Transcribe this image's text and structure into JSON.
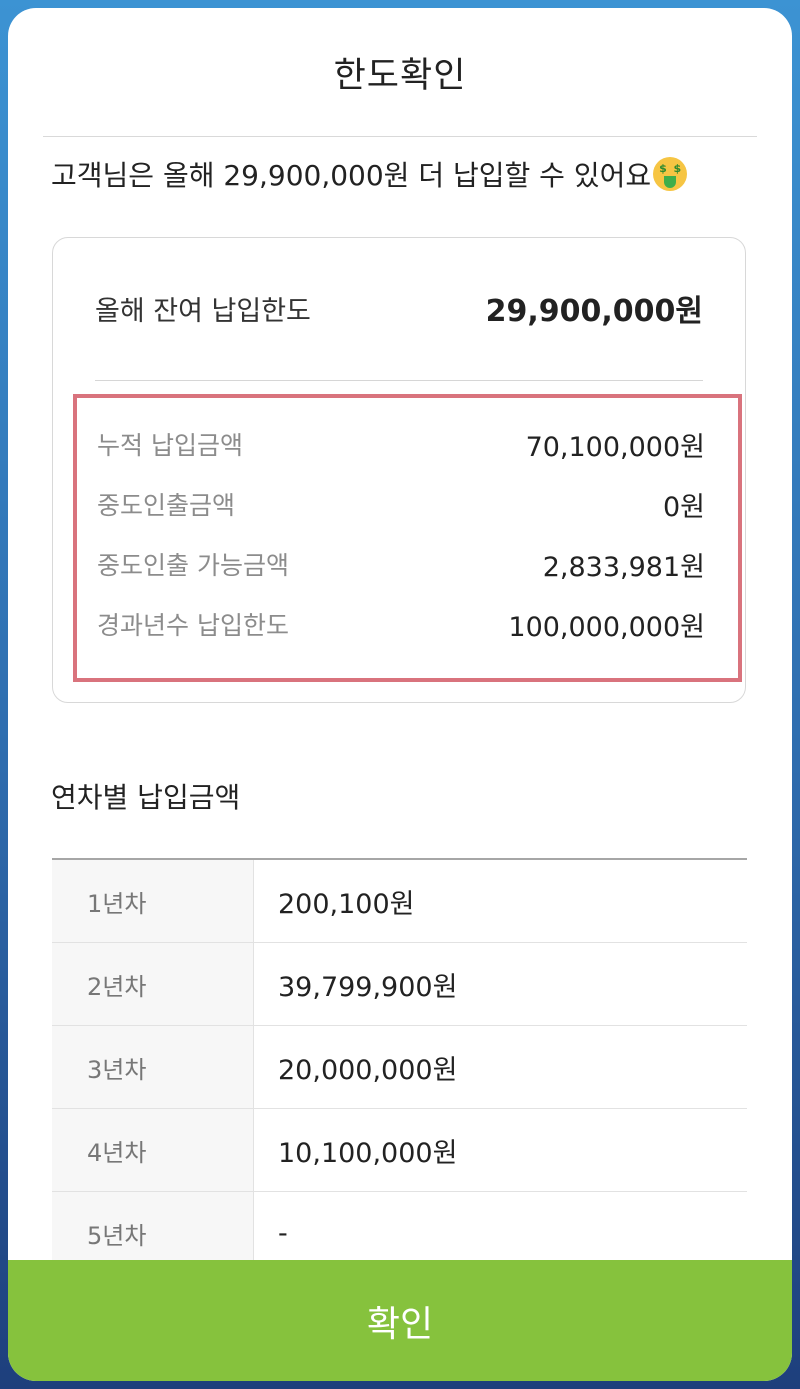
{
  "header": {
    "title": "한도확인"
  },
  "summary": {
    "text": "고객님은 올해 29,900,000원 더 납입할 수 있어요",
    "emoji_icon": "money-mouth-face-icon"
  },
  "card": {
    "remaining_limit_label": "올해 잔여 납입한도",
    "remaining_limit_value": "29,900,000원",
    "details": [
      {
        "label": "누적 납입금액",
        "value": "70,100,000원"
      },
      {
        "label": "중도인출금액",
        "value": "0원"
      },
      {
        "label": "중도인출 가능금액",
        "value": "2,833,981원"
      },
      {
        "label": "경과년수 납입한도",
        "value": "100,000,000원"
      }
    ],
    "highlight_color": "#d9737d"
  },
  "yearly": {
    "title": "연차별 납입금액",
    "rows": [
      {
        "year": "1년차",
        "amount": "200,100원"
      },
      {
        "year": "2년차",
        "amount": "39,799,900원"
      },
      {
        "year": "3년차",
        "amount": "20,000,000원"
      },
      {
        "year": "4년차",
        "amount": "10,100,000원"
      },
      {
        "year": "5년차",
        "amount": "-"
      }
    ]
  },
  "footer": {
    "confirm_label": "확인"
  },
  "colors": {
    "confirm_button": "#86c23d",
    "background_top": "#3c93d3",
    "background_bottom": "#1e3f7c"
  }
}
